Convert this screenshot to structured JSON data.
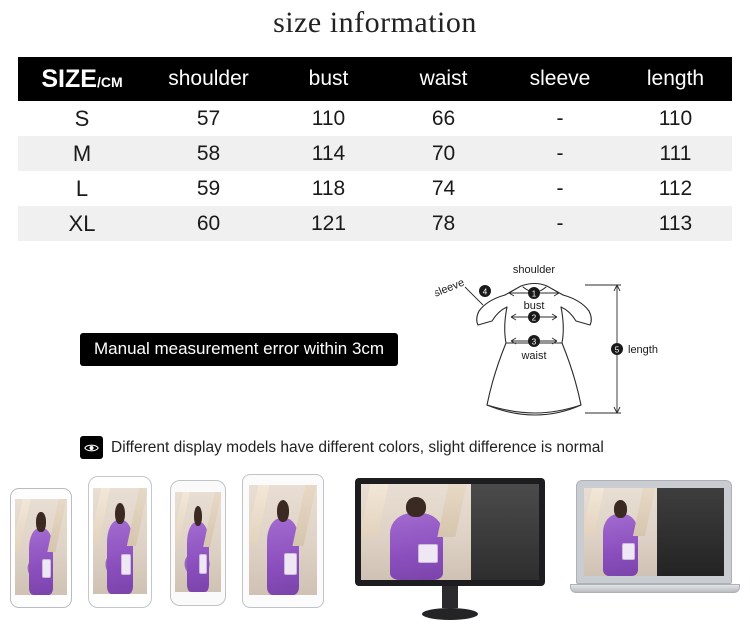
{
  "title": "size information",
  "table": {
    "headers": [
      "SIZE",
      "/CM",
      "shoulder",
      "bust",
      "waist",
      "sleeve",
      "length"
    ],
    "rows": [
      {
        "size": "S",
        "shoulder": "57",
        "bust": "110",
        "waist": "66",
        "sleeve": "-",
        "length": "110"
      },
      {
        "size": "M",
        "shoulder": "58",
        "bust": "114",
        "waist": "70",
        "sleeve": "-",
        "length": "111"
      },
      {
        "size": "L",
        "shoulder": "59",
        "bust": "118",
        "waist": "74",
        "sleeve": "-",
        "length": "112"
      },
      {
        "size": "XL",
        "shoulder": "60",
        "bust": "121",
        "waist": "78",
        "sleeve": "-",
        "length": "113"
      }
    ]
  },
  "note_badge": "Manual measurement error within 3cm",
  "diagram": {
    "labels": {
      "sleeve": "sleeve",
      "shoulder": "shoulder",
      "bust": "bust",
      "waist": "waist",
      "length": "length"
    },
    "markers": {
      "shoulder": "1",
      "bust": "2",
      "waist": "3",
      "sleeve": "4",
      "length": "5"
    }
  },
  "eye_note": {
    "icon": "eye-icon",
    "text": "Different display models have different colors,   slight difference is normal"
  },
  "devices": [
    {
      "name": "smartphone-samsung"
    },
    {
      "name": "smartphone-white"
    },
    {
      "name": "smartphone-iphone"
    },
    {
      "name": "tablet"
    },
    {
      "name": "desktop-monitor"
    },
    {
      "name": "laptop"
    }
  ],
  "colors": {
    "header_bg": "#000000",
    "alt_row_bg": "#f0f0f0",
    "text": "#1a1a1a",
    "accent_purple": "#8b4fbd"
  }
}
